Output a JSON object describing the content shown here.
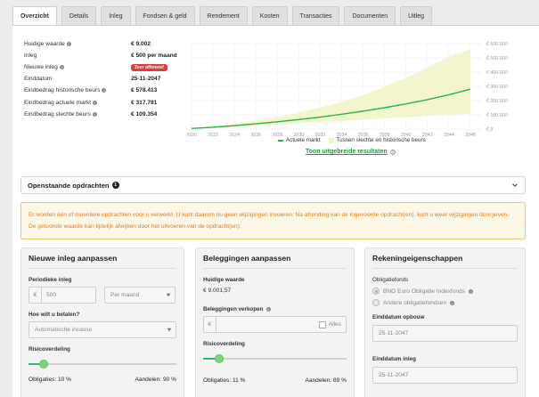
{
  "tabs": [
    "Overzicht",
    "Details",
    "Inleg",
    "Fondsen & geld",
    "Rendement",
    "Kosten",
    "Transacties",
    "Documenten",
    "Uitleg"
  ],
  "summary": {
    "rows": [
      {
        "label": "Huidige waarde",
        "value": "€ 9.002"
      },
      {
        "label": "Inleg",
        "value": "€ 500 per maand"
      },
      {
        "label": "Nieuwe inleg",
        "badge": "Zeer offensief"
      },
      {
        "label": "Einddatum",
        "value": "25-11-2047"
      },
      {
        "label": "Eindbedrag historische beurs",
        "value": "€ 578.413"
      },
      {
        "label": "Eindbedrag actuele markt",
        "value": "€ 317.781"
      },
      {
        "label": "Eindbedrag slechte beurs",
        "value": "€ 109.354"
      }
    ]
  },
  "chart_data": {
    "type": "area",
    "x": [
      2020,
      2022,
      2024,
      2026,
      2028,
      2030,
      2032,
      2034,
      2036,
      2038,
      2040,
      2042,
      2044,
      2046
    ],
    "xlim": [
      2020,
      2047
    ],
    "ylim": [
      0,
      600000
    ],
    "y_ticks": [
      "€ 0",
      "€ 100.000",
      "€ 200.000",
      "€ 300.000",
      "€ 400.000",
      "€ 500.000",
      "€ 600.000"
    ],
    "series": [
      {
        "name": "Actuele markt",
        "type": "line",
        "color": "#2bb24c",
        "values": [
          4000,
          13000,
          24000,
          37000,
          51000,
          67000,
          84000,
          104000,
          126000,
          150000,
          177000,
          207000,
          241000,
          280000
        ]
      },
      {
        "name": "Tussen slechte en historische beurs",
        "type": "band",
        "color": "#f2f5c8",
        "upper": [
          6000,
          20000,
          38000,
          60000,
          86000,
          116000,
          151000,
          192000,
          240000,
          296000,
          360000,
          432000,
          512000,
          560000
        ],
        "lower": [
          3000,
          9000,
          16000,
          23000,
          31000,
          39000,
          48000,
          57000,
          66000,
          75000,
          84000,
          93000,
          101000,
          108000
        ]
      }
    ],
    "legend": "bottom",
    "grid": true
  },
  "legend": {
    "item1": "Actuele markt",
    "item2": "Tussen slechte en historische beurs"
  },
  "results_link": "Toon uitgebreide resultaten",
  "pending": {
    "title": "Openstaande opdrachten",
    "count": "1"
  },
  "warning": "Er worden één of meerdere opdrachten voor u verwerkt. U kunt daarom nu geen wijzigingen invoeren. Na afronding van de ingevoerde opdracht(en), kunt u weer wijzigingen doorgeven. De getoonde waarde kan tijdelijk afwijken door het uitvoeren van de opdracht(en).",
  "col1": {
    "title": "Nieuwe inleg aanpassen",
    "periodic_label": "Periodieke inleg",
    "currency": "€",
    "amount": "500",
    "period": "Per maand",
    "pay_label": "Hoe wilt u betalen?",
    "pay_method": "Automatische incasso",
    "risk_label": "Risicoverdeling",
    "risk": 0.1,
    "bonds": "Obligaties: 10 %",
    "stocks": "Aandelen: 90 %"
  },
  "col2": {
    "title": "Beleggingen aanpassen",
    "value_label": "Huidige waarde",
    "value": "€ 9.001,57",
    "sell_label": "Beleggingen verkopen",
    "currency": "€",
    "all_label": "Alles",
    "risk_label": "Risicoverdeling",
    "risk": 0.11,
    "bonds": "Obligaties: 11 %",
    "stocks": "Aandelen: 89 %"
  },
  "col3": {
    "title": "Rekeningeigenschappen",
    "fund_label": "Obligatiefonds",
    "fund_opt1": "BNO Euro Obligatie Indexfonds",
    "fund_opt2": "Andere obligatiefondsen",
    "end_build_label": "Einddatum opbouw",
    "end_build": "25-11-2047",
    "end_dep_label": "Einddatum inleg",
    "end_dep": "25-11-2047"
  }
}
